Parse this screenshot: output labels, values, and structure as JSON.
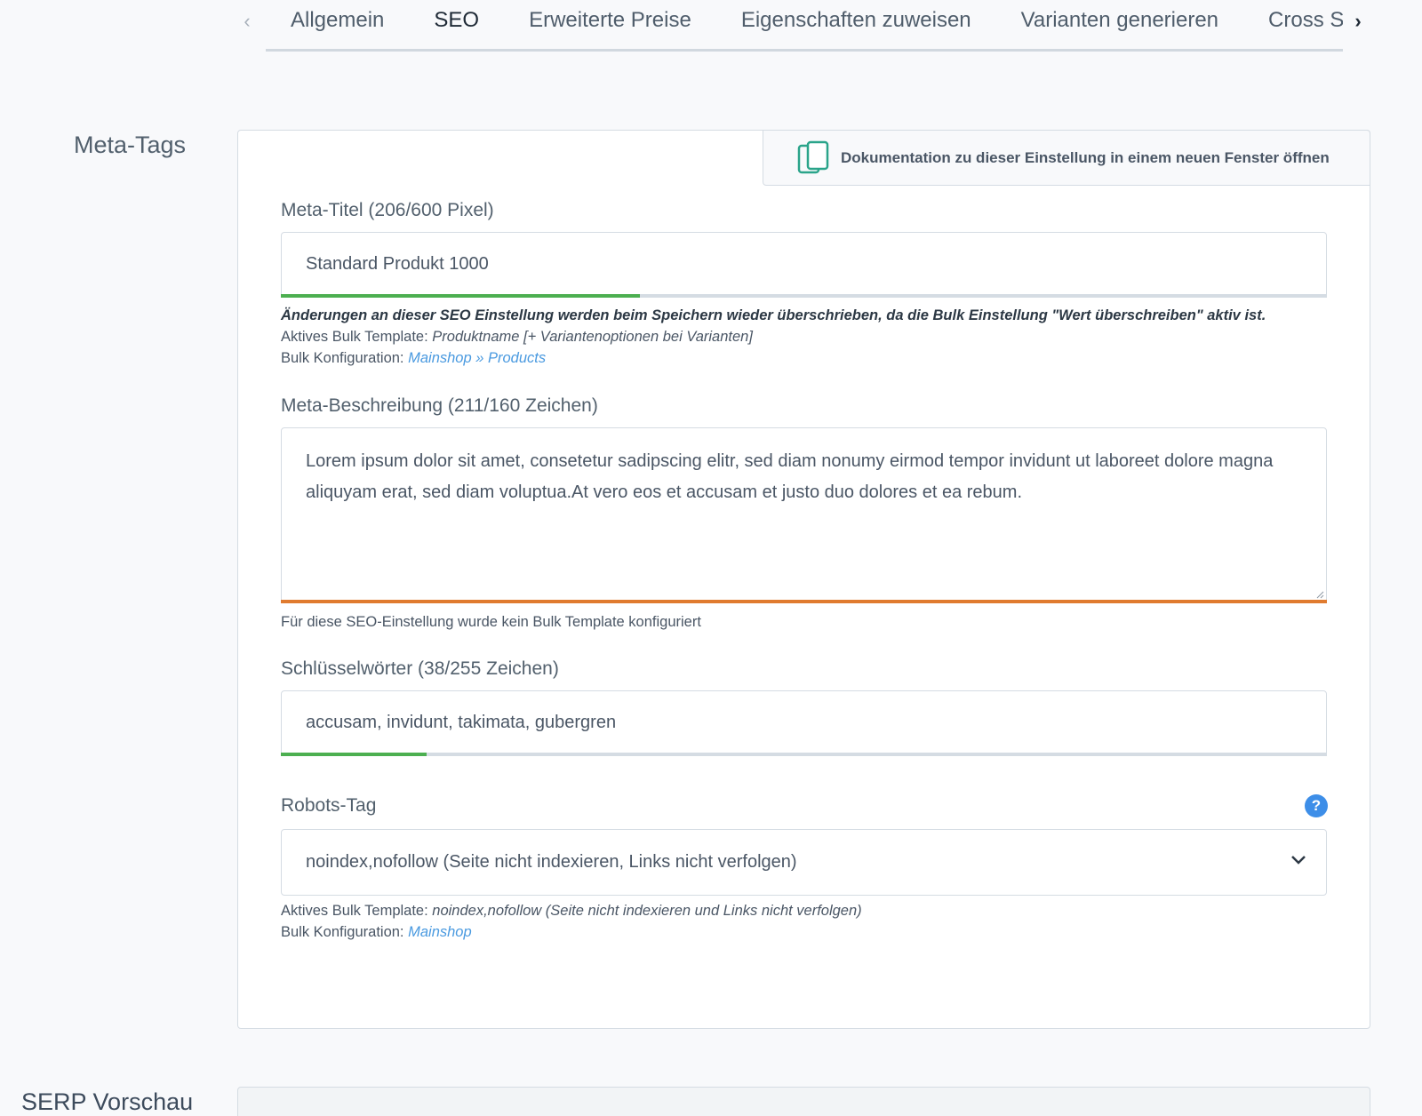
{
  "tabs": {
    "items": [
      {
        "label": "Allgemein"
      },
      {
        "label": "SEO"
      },
      {
        "label": "Erweiterte Preise"
      },
      {
        "label": "Eigenschaften zuweisen"
      },
      {
        "label": "Varianten generieren"
      },
      {
        "label": "Cross Sel"
      }
    ],
    "active": "SEO",
    "prev_icon": "chevron-left-icon",
    "next_icon": "chevron-right-icon"
  },
  "sections": {
    "meta_tags": "Meta-Tags",
    "serp_preview": "SERP Vorschau"
  },
  "doc_link": {
    "icon": "copy-documents-icon",
    "label": "Dokumentation zu dieser Einstellung in einem neuen Fenster öffnen"
  },
  "meta_title": {
    "label": "Meta-Titel (206/600 Pixel)",
    "value": "Standard Produkt 1000",
    "progress": 0.343,
    "progress_color": "#4caf50",
    "warning": "Änderungen an dieser SEO Einstellung werden beim Speichern wieder überschrieben, da die Bulk Einstellung \"Wert überschreiben\" aktiv ist.",
    "template_label": "Aktives Bulk Template:",
    "template_value": "Produktname [+ Variantenoptionen bei Varianten]",
    "config_label": "Bulk Konfiguration:",
    "config_link": "Mainshop » Products"
  },
  "meta_description": {
    "label": "Meta-Beschreibung (211/160 Zeichen)",
    "value": "Lorem ipsum dolor sit amet, consetetur sadipscing elitr, sed diam nonumy eirmod tempor invidunt ut laboreet dolore magna aliquyam erat, sed diam voluptua.At vero eos et accusam et justo duo dolores et ea rebum.",
    "progress": 1.0,
    "progress_color": "#e07b2f",
    "hint": "Für diese SEO-Einstellung wurde kein Bulk Template konfiguriert"
  },
  "keywords": {
    "label": "Schlüsselwörter (38/255 Zeichen)",
    "value": "accusam, invidunt, takimata, gubergren",
    "progress": 0.139,
    "progress_color": "#4caf50"
  },
  "robots": {
    "label": "Robots-Tag",
    "help_icon": "question-circle-icon",
    "help_glyph": "?",
    "selected": "noindex,nofollow (Seite nicht indexieren, Links nicht verfolgen)",
    "template_label": "Aktives Bulk Template:",
    "template_value": "noindex,nofollow (Seite nicht indexieren und Links nicht verfolgen)",
    "config_label": "Bulk Konfiguration:",
    "config_link": "Mainshop"
  }
}
